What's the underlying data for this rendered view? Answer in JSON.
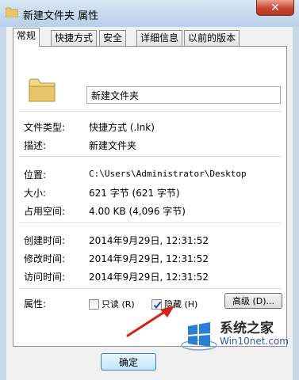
{
  "window": {
    "title": "新建文件夹 属性",
    "close_label": "✕"
  },
  "tabs": [
    {
      "label": "常规",
      "active": true
    },
    {
      "label": "快捷方式",
      "active": false
    },
    {
      "label": "安全",
      "active": false
    },
    {
      "label": "详细信息",
      "active": false
    },
    {
      "label": "以前的版本",
      "active": false
    }
  ],
  "general": {
    "name_value": "新建文件夹",
    "file_type_label": "文件类型:",
    "file_type_value": "快捷方式 (.lnk)",
    "description_label": "描述:",
    "description_value": "新建文件夹",
    "location_label": "位置:",
    "location_value": "C:\\Users\\Administrator\\Desktop",
    "size_label": "大小:",
    "size_value": "621 字节 (621 字节)",
    "size_on_disk_label": "占用空间:",
    "size_on_disk_value": "4.00 KB (4,096 字节)",
    "created_label": "创建时间:",
    "created_value": "2014年9月29日, 12:31:52",
    "modified_label": "修改时间:",
    "modified_value": "2014年9月29日, 12:31:52",
    "accessed_label": "访问时间:",
    "accessed_value": "2014年9月29日, 12:31:52",
    "attributes_label": "属性:",
    "readonly_label": "只读 (R)",
    "readonly_checked": false,
    "hidden_label": "隐藏 (H)",
    "hidden_checked": true,
    "advanced_label": "高级 (D)..."
  },
  "footer": {
    "ok_label": "确定"
  },
  "watermark": {
    "title": "系统之家",
    "url": "Win10net.com"
  },
  "colors": {
    "arrow": "#d9211c",
    "checkmark": "#1c4f9c",
    "folder": "#e8c46a"
  }
}
